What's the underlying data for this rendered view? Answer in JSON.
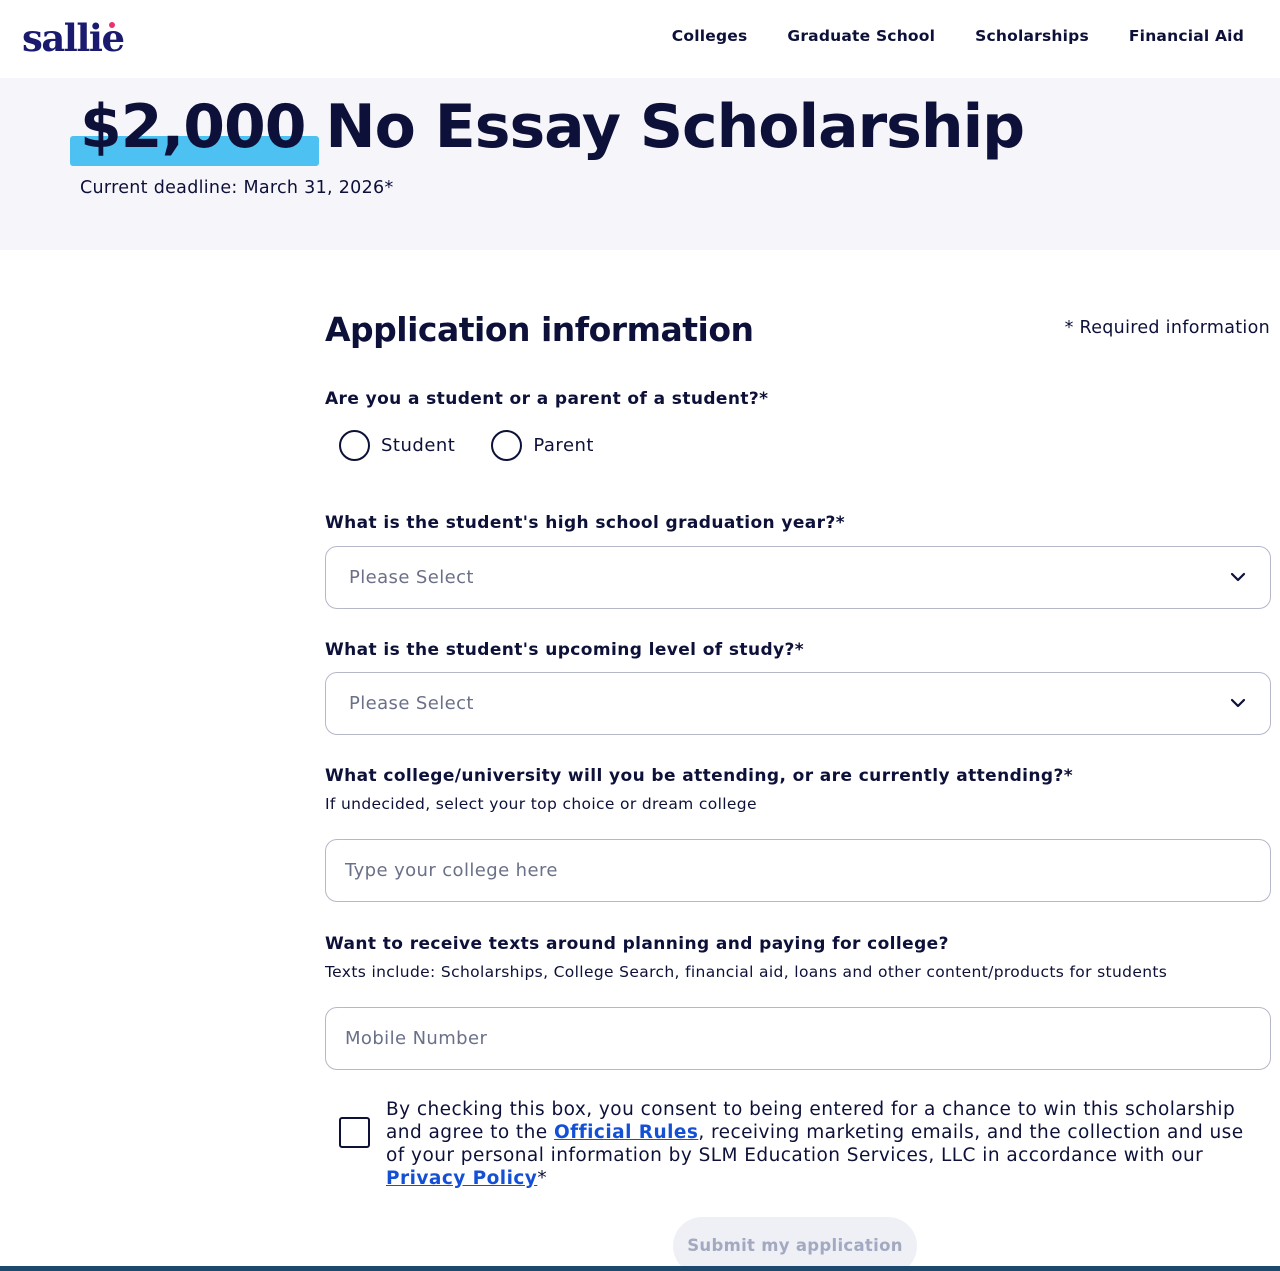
{
  "header": {
    "logo_text": "sallie",
    "nav": [
      "Colleges",
      "Graduate School",
      "Scholarships",
      "Financial Aid"
    ]
  },
  "hero": {
    "amount": "$2,000",
    "title_rest": " No Essay Scholarship",
    "deadline": "Current deadline: March 31, 2026*"
  },
  "form": {
    "title": "Application information",
    "required_note": "* Required information",
    "q_role": {
      "label": "Are you a student or a parent of a student?*",
      "options": [
        "Student",
        "Parent"
      ]
    },
    "q_grad_year": {
      "label": "What is the student's high school graduation year?*",
      "placeholder": "Please Select"
    },
    "q_level": {
      "label": "What is the student's upcoming level of study?*",
      "placeholder": "Please Select"
    },
    "q_college": {
      "label": "What college/university will you be attending, or are currently attending?*",
      "sub": "If undecided, select your top choice or dream college",
      "placeholder": "Type your college here"
    },
    "q_texts": {
      "label": "Want to receive texts around planning and paying for college?",
      "sub": "Texts include: Scholarships, College Search, financial aid, loans and other content/products for students",
      "placeholder": "Mobile Number"
    },
    "consent": {
      "text_1": "By checking this box, you consent to being entered for a chance to win this scholarship and agree to the ",
      "link_rules": "Official Rules",
      "text_2": ", receiving marketing emails, and the collection and use of your personal information by SLM Education Services, LLC in accordance with our ",
      "link_privacy": "Privacy Policy",
      "text_3": "*"
    },
    "submit_label": "Submit my application"
  },
  "colors": {
    "navy": "#0d1038",
    "highlight": "#4dc1f2",
    "link": "#1450d6",
    "hero_bg": "#f6f5fa"
  }
}
